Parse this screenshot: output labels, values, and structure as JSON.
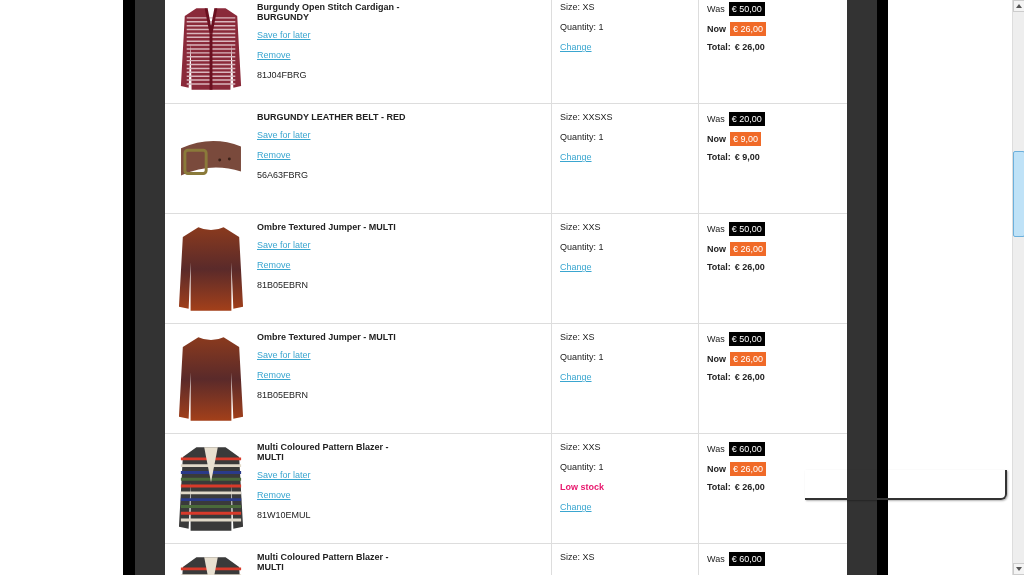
{
  "cart_items": [
    {
      "kind": "cardigan",
      "name": "Burgundy Open Stitch Cardigan - BURGUNDY",
      "save_link": "Save for later",
      "remove_link": "Remove",
      "code": "81J04FBRG",
      "size": "Size: XS",
      "quantity": "Quantity: 1",
      "change_link": "Change",
      "was_label": "Was",
      "was": "€ 50,00",
      "now_label": "Now",
      "now": "€ 26,00",
      "total_label": "Total:",
      "total": "€ 26,00"
    },
    {
      "kind": "belt",
      "name": "BURGUNDY LEATHER BELT - RED",
      "save_link": "Save for later",
      "remove_link": "Remove",
      "code": "56A63FBRG",
      "size": "Size: XXSXS",
      "quantity": "Quantity: 1",
      "change_link": "Change",
      "was_label": "Was",
      "was": "€ 20,00",
      "now_label": "Now",
      "now": "€ 9,00",
      "total_label": "Total:",
      "total": "€ 9,00"
    },
    {
      "kind": "jumper",
      "name": "Ombre Textured Jumper - MULTI",
      "save_link": "Save for later",
      "remove_link": "Remove",
      "code": "81B05EBRN",
      "size": "Size: XXS",
      "quantity": "Quantity: 1",
      "change_link": "Change",
      "was_label": "Was",
      "was": "€ 50,00",
      "now_label": "Now",
      "now": "€ 26,00",
      "total_label": "Total:",
      "total": "€ 26,00"
    },
    {
      "kind": "jumper",
      "name": "Ombre Textured Jumper - MULTI",
      "save_link": "Save for later",
      "remove_link": "Remove",
      "code": "81B05EBRN",
      "size": "Size: XS",
      "quantity": "Quantity: 1",
      "change_link": "Change",
      "was_label": "Was",
      "was": "€ 50,00",
      "now_label": "Now",
      "now": "€ 26,00",
      "total_label": "Total:",
      "total": "€ 26,00"
    },
    {
      "kind": "blazer",
      "name": "Multi Coloured Pattern Blazer - MULTI",
      "save_link": "Save for later",
      "remove_link": "Remove",
      "code": "81W10EMUL",
      "size": "Size: XXS",
      "quantity": "Quantity: 1",
      "stock_note": "Low stock",
      "change_link": "Change",
      "was_label": "Was",
      "was": "€ 60,00",
      "now_label": "Now",
      "now": "€ 26,00",
      "total_label": "Total:",
      "total": "€ 26,00"
    },
    {
      "kind": "blazer",
      "name": "Multi Coloured Pattern Blazer - MULTI",
      "size": "Size: XS",
      "was_label": "Was",
      "was": "€ 60,00"
    }
  ]
}
